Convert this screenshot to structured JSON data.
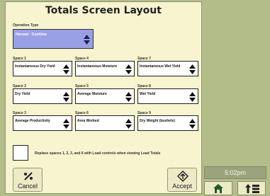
{
  "title": "Totals Screen Layout",
  "operation": {
    "label": "Operation Type",
    "value": "Harvest - Combine"
  },
  "spaces": [
    {
      "label": "Space 1",
      "value": "Instantaneous Dry Yield"
    },
    {
      "label": "Space 4",
      "value": "Instantaneous Moisture"
    },
    {
      "label": "Space 7",
      "value": "Instantaneous Wet Yield"
    },
    {
      "label": "Space 2",
      "value": "Dry Yield"
    },
    {
      "label": "Space 5",
      "value": "Average Moisture"
    },
    {
      "label": "Space 8",
      "value": "Wet Yield"
    },
    {
      "label": "Space 3",
      "value": "Average Productivity"
    },
    {
      "label": "Space 6",
      "value": "Area Worked"
    },
    {
      "label": "Space 9",
      "value": "Dry Weight (bushels)"
    }
  ],
  "checkbox_text": "Replace spaces 1, 2, 3, and 6 with Load controls when viewing Load Totals",
  "buttons": {
    "cancel": "Cancel",
    "accept": "Accept"
  },
  "status": {
    "time": "5:02pm"
  },
  "colors": {
    "panel": "#f7f4cf",
    "operation_field": "#9aa0e6",
    "side_bg": "#b3bd8a"
  }
}
